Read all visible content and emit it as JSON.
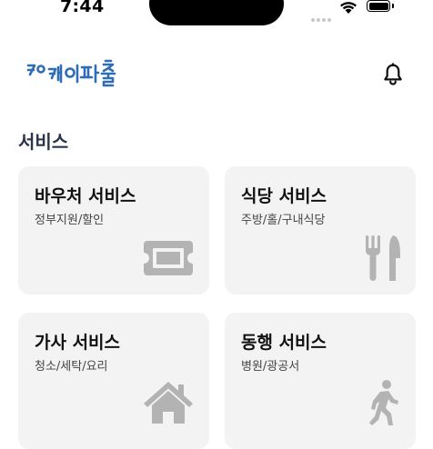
{
  "status_bar": {
    "time": "7:44"
  },
  "header": {
    "logo_text": "케이파출",
    "logo_icon": "kpachul-logo",
    "bell_icon": "bell-icon"
  },
  "section": {
    "title": "서비스"
  },
  "cards": [
    {
      "title": "바우처 서비스",
      "subtitle": "정부지원/할인",
      "icon": "ticket-icon"
    },
    {
      "title": "식당 서비스",
      "subtitle": "주방/홀/구내식당",
      "icon": "fork-knife-icon"
    },
    {
      "title": "가사 서비스",
      "subtitle": "청소/세탁/요리",
      "icon": "house-icon"
    },
    {
      "title": "동행 서비스",
      "subtitle": "병원/광공서",
      "icon": "walking-person-icon"
    }
  ],
  "colors": {
    "logo_blue": "#2f6db5",
    "card_bg": "#f3f3f3",
    "icon_gray": "#b3b3b3",
    "section_title": "#2b3547"
  }
}
